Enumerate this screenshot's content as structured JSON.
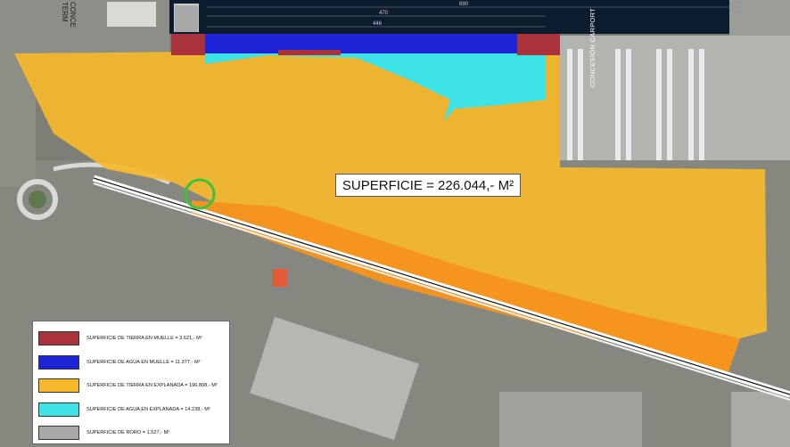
{
  "surface_total": "SUPERFICIE = 226.044,- M²",
  "concession_carport": "CONCESIÓN CARPORT",
  "concession_terminal": "CONCE\nTERM",
  "dimensions": [
    "690",
    "470",
    "446"
  ],
  "legend": [
    {
      "label": "SUPERFICIE DE TIERRA EN MUELLE = 3.621,- M²",
      "color": "#a8333a"
    },
    {
      "label": "SUPERFICIE DE AGUA EN MUELLE = 11.377,- M²",
      "color": "#1e23d6"
    },
    {
      "label": "SUPERFICIE DE TIERRA EN EXPLANADA = 196.808,- M²",
      "color": "#f6b92c"
    },
    {
      "label": "SUPERFICIE DE AGUA EN EXPLANADA = 14.238,- M²",
      "color": "#3ee3e8"
    },
    {
      "label": "SUPERFICIE DE RORO = 1.527,- M²",
      "color": "#a9a9a9"
    }
  ],
  "colors": {
    "land_dock": "#a8333a",
    "water_dock": "#1e23d6",
    "land_esplanade": "#f6b92c",
    "water_esplanade": "#3ee3e8",
    "roro": "#a9a9a9",
    "rail_strip": "#f7941d"
  }
}
